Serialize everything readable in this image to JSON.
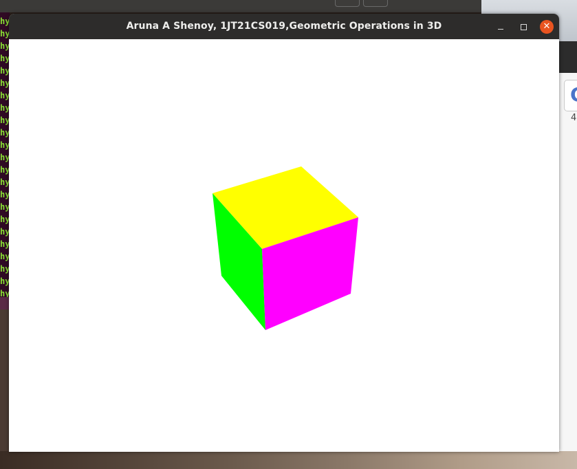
{
  "window": {
    "title": "Aruna A Shenoy, 1JT21CS019,Geometric Operations in 3D",
    "controls": {
      "minimize_icon": "minimize-icon",
      "maximize_icon": "maximize-icon",
      "close_icon": "close-icon",
      "close_glyph": "✕"
    }
  },
  "canvas": {
    "background": "#ffffff",
    "cube": {
      "faces": [
        {
          "name": "top-face",
          "color": "#ffff00"
        },
        {
          "name": "left-face",
          "color": "#00ff00"
        },
        {
          "name": "right-face",
          "color": "#ff00ff"
        }
      ]
    }
  },
  "background": {
    "terminal_prefix": "hy",
    "right_card_letter": "G",
    "right_number": "4"
  },
  "colors": {
    "titlebar": "#2d2c2b",
    "close_button": "#e95420",
    "terminal_text": "#8ae234",
    "terminal_bg": "#300a24"
  }
}
